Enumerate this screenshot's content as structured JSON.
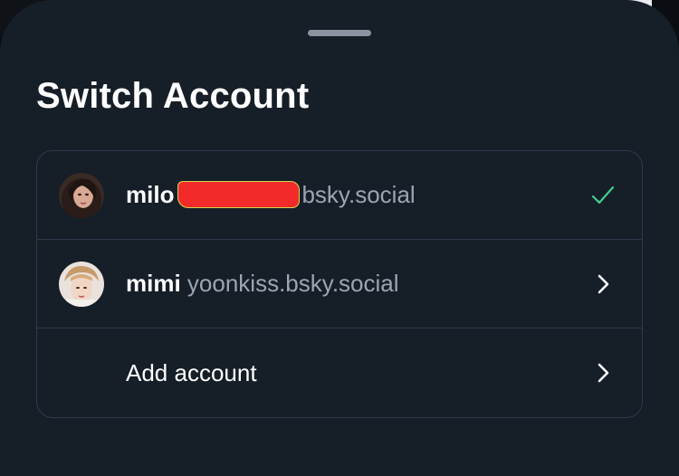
{
  "sheet": {
    "title": "Switch Account"
  },
  "accounts": [
    {
      "display_name": "milo",
      "handle_suffix": "bsky.social",
      "handle_redacted": true,
      "status_icon": "check-icon",
      "selected": true
    },
    {
      "display_name": "mimi",
      "handle": "yoonkiss.bsky.social",
      "status_icon": "chevron-right-icon",
      "selected": false
    }
  ],
  "add_account": {
    "label": "Add account",
    "icon": "chevron-right-icon"
  },
  "colors": {
    "sheet_bg": "#161e27",
    "border": "#2e3b4b",
    "text_primary": "#ffffff",
    "text_secondary": "#9aa6b3",
    "check": "#3fd08c",
    "redaction": "#f22a2a"
  }
}
